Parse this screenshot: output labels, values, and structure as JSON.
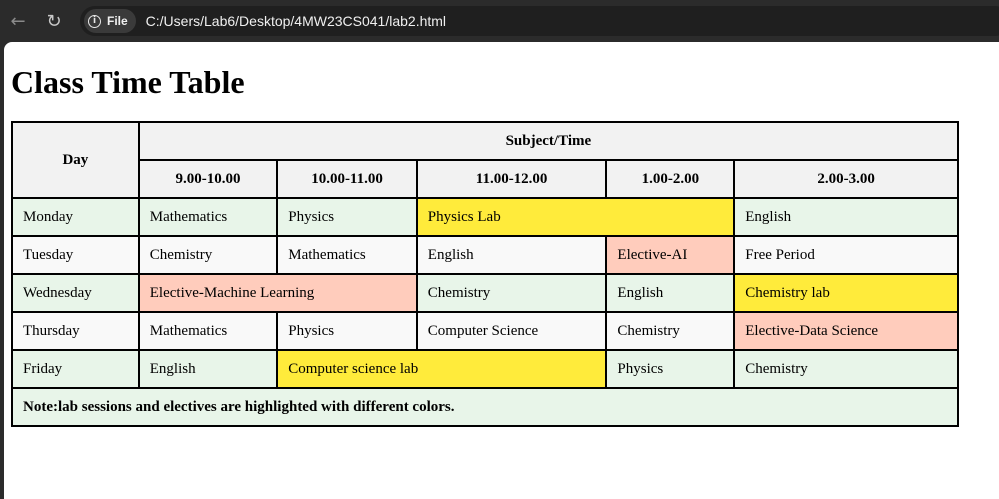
{
  "browser": {
    "chip_label": "File",
    "url": "C:/Users/Lab6/Desktop/4MW23CS041/lab2.html",
    "back_icon": "←",
    "reload_icon": "↻",
    "info_icon": "i"
  },
  "page": {
    "title": "Class Time Table"
  },
  "table": {
    "header": {
      "day": "Day",
      "subject_time": "Subject/Time",
      "slots": [
        "9.00-10.00",
        "10.00-11.00",
        "11.00-12.00",
        "1.00-2.00",
        "2.00-3.00"
      ]
    },
    "rows": [
      {
        "day": "Monday",
        "cells": [
          "Mathematics",
          "Physics",
          "Physics Lab",
          "English"
        ]
      },
      {
        "day": "Tuesday",
        "cells": [
          "Chemistry",
          "Mathematics",
          "English",
          "Elective-AI",
          "Free Period"
        ]
      },
      {
        "day": "Wednesday",
        "cells": [
          "Elective-Machine Learning",
          "Chemistry",
          "English",
          "Chemistry lab"
        ]
      },
      {
        "day": "Thursday",
        "cells": [
          "Mathematics",
          "Physics",
          "Computer Science",
          "Chemistry",
          "Elective-Data Science"
        ]
      },
      {
        "day": "Friday",
        "cells": [
          "English",
          "Computer science lab",
          "Physics",
          "Chemistry"
        ]
      }
    ],
    "note": "Note:lab sessions and electives are highlighted with different colors."
  },
  "colors": {
    "regular_row": "#e8f5e9",
    "alt_row": "#f9f9f9",
    "lab": "#ffeb3b",
    "elective": "#ffccbc",
    "header": "#f2f2f2"
  }
}
